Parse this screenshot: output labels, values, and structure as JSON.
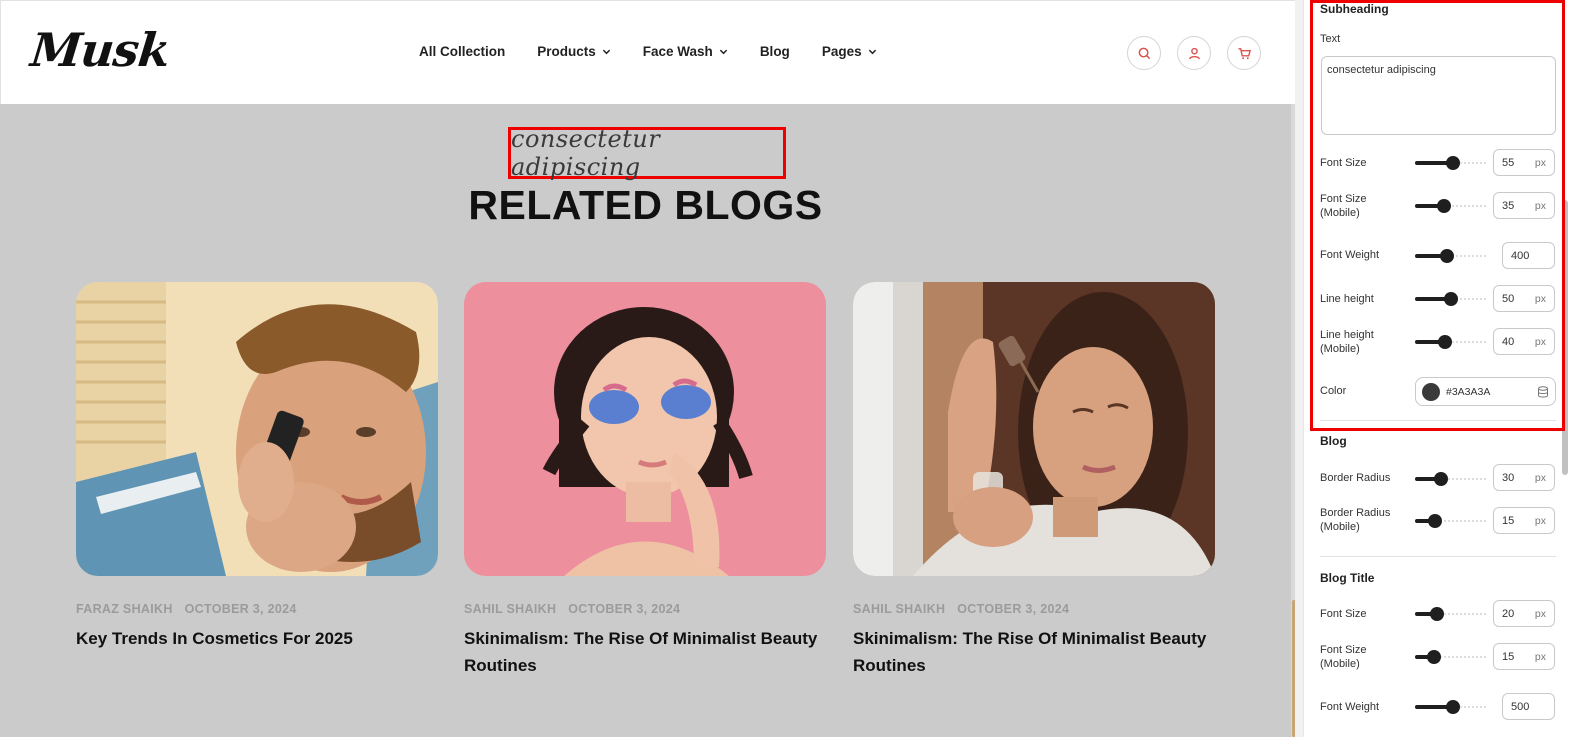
{
  "store": {
    "logo": "Musk",
    "nav": [
      {
        "label": "All Collection",
        "has_dropdown": false
      },
      {
        "label": "Products",
        "has_dropdown": true
      },
      {
        "label": "Face Wash",
        "has_dropdown": true
      },
      {
        "label": "Blog",
        "has_dropdown": false
      },
      {
        "label": "Pages",
        "has_dropdown": true
      }
    ],
    "icons": [
      "search-icon",
      "user-icon",
      "cart-icon"
    ],
    "accent_color": "#d9534f"
  },
  "section": {
    "subheading": "consectetur adipiscing",
    "title": "RELATED BLOGS",
    "background": "#cbcbcb"
  },
  "blogs": [
    {
      "author": "FARAZ SHAIKH",
      "date": "OCTOBER 3, 2024",
      "title": "Key Trends In Cosmetics For 2025",
      "image": "man-shaving-beard"
    },
    {
      "author": "SAHIL SHAIKH",
      "date": "OCTOBER 3, 2024",
      "title": "Skinimalism: The Rise Of Minimalist Beauty Routines",
      "image": "woman-eye-patches-pink"
    },
    {
      "author": "SAHIL SHAIKH",
      "date": "OCTOBER 3, 2024",
      "title": "Skinimalism: The Rise Of Minimalist Beauty Routines",
      "image": "woman-applying-serum"
    }
  ],
  "panel": {
    "subheading_section": {
      "title": "Subheading",
      "text_label": "Text",
      "text_value": "consectetur adipiscing",
      "font_size": {
        "label": "Font Size",
        "value": "55",
        "unit": "px",
        "slider_fraction": 0.55
      },
      "font_size_mobile": {
        "label_1": "Font Size",
        "label_2": "(Mobile)",
        "value": "35",
        "unit": "px",
        "slider_fraction": 0.38
      },
      "font_weight": {
        "label": "Font Weight",
        "value": "400",
        "slider_fraction": 0.44
      },
      "line_height": {
        "label": "Line height",
        "value": "50",
        "unit": "px",
        "slider_fraction": 0.5
      },
      "line_height_mobile": {
        "label_1": "Line height",
        "label_2": "(Mobile)",
        "value": "40",
        "unit": "px",
        "slider_fraction": 0.41
      },
      "color": {
        "label": "Color",
        "value": "#3A3A3A",
        "swatch": "#3a3a3a"
      }
    },
    "blog_section": {
      "title": "Blog",
      "border_radius": {
        "label": "Border Radius",
        "value": "30",
        "unit": "px",
        "slider_fraction": 0.33
      },
      "border_radius_mobile": {
        "label_1": "Border Radius",
        "label_2": "(Mobile)",
        "value": "15",
        "unit": "px",
        "slider_fraction": 0.22
      }
    },
    "blog_title_section": {
      "title": "Blog Title",
      "font_size": {
        "label": "Font Size",
        "value": "20",
        "unit": "px",
        "slider_fraction": 0.27
      },
      "font_size_mobile": {
        "label_1": "Font Size",
        "label_2": "(Mobile)",
        "value": "15",
        "unit": "px",
        "slider_fraction": 0.21
      },
      "font_weight": {
        "label": "Font Weight",
        "value": "500",
        "slider_fraction": 0.55
      }
    }
  }
}
